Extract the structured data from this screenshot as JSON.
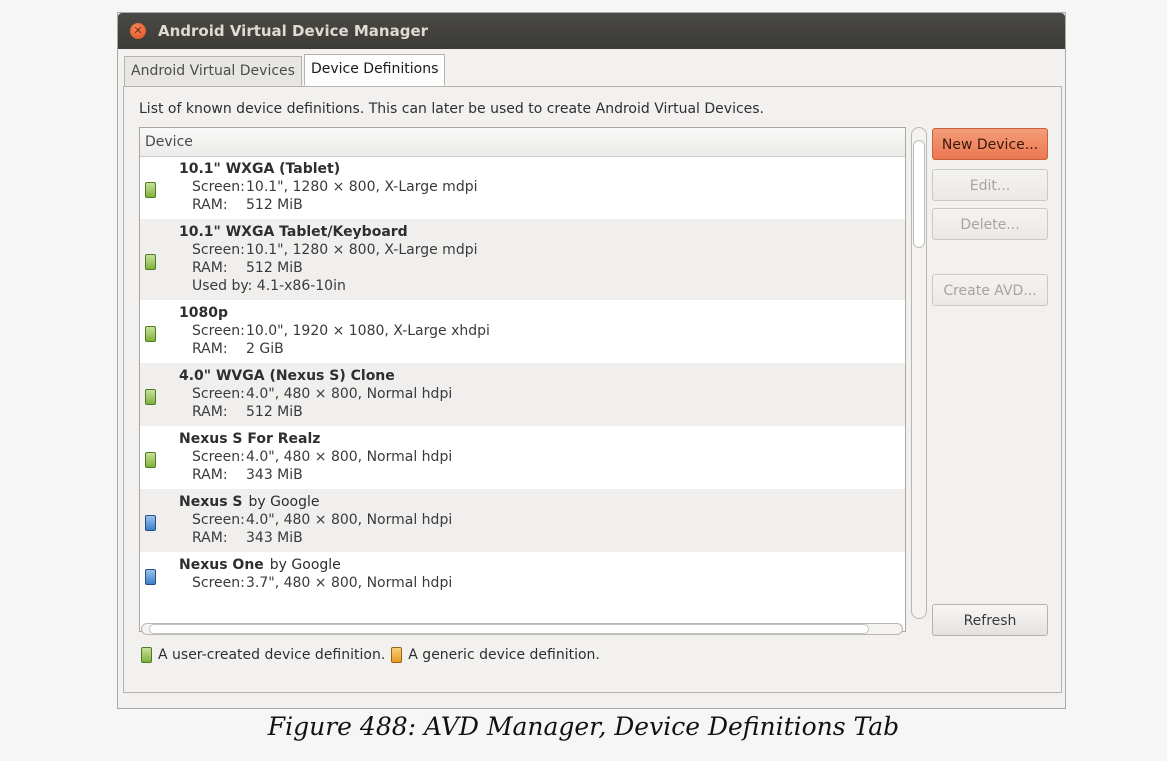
{
  "window": {
    "title": "Android Virtual Device Manager"
  },
  "tabs": [
    {
      "label": "Android Virtual Devices",
      "active": false
    },
    {
      "label": "Device Definitions",
      "active": true
    }
  ],
  "panel": {
    "description": "List of known device definitions. This can later be used to create Android Virtual Devices.",
    "column_header": "Device"
  },
  "devices": [
    {
      "name": "10.1\" WXGA (Tablet)",
      "by": "",
      "icon": "user-device-icon",
      "screen": "10.1\", 1280 × 800, X-Large mdpi",
      "ram": "512 MiB",
      "used_by": ""
    },
    {
      "name": "10.1\" WXGA Tablet/Keyboard",
      "by": "",
      "icon": "user-device-icon",
      "screen": "10.1\", 1280 × 800, X-Large mdpi",
      "ram": "512 MiB",
      "used_by": "Used by: 4.1-x86-10in"
    },
    {
      "name": "1080p",
      "by": "",
      "icon": "user-device-icon",
      "screen": "10.0\", 1920 × 1080, X-Large xhdpi",
      "ram": "2 GiB",
      "used_by": ""
    },
    {
      "name": "4.0\" WVGA (Nexus S) Clone",
      "by": "",
      "icon": "user-device-icon",
      "screen": "4.0\", 480 × 800, Normal hdpi",
      "ram": "512 MiB",
      "used_by": ""
    },
    {
      "name": "Nexus S For Realz",
      "by": "",
      "icon": "user-device-icon",
      "screen": "4.0\", 480 × 800, Normal hdpi",
      "ram": "343 MiB",
      "used_by": ""
    },
    {
      "name": "Nexus S",
      "by": "by Google",
      "icon": "generic-device-icon",
      "screen": "4.0\", 480 × 800, Normal hdpi",
      "ram": "343 MiB",
      "used_by": ""
    },
    {
      "name": "Nexus One",
      "by": "by Google",
      "icon": "generic-device-icon",
      "screen": "3.7\", 480 × 800, Normal hdpi",
      "ram": "",
      "used_by": ""
    }
  ],
  "labels": {
    "screen": "Screen:",
    "ram": "RAM:"
  },
  "buttons": {
    "new_device": "New Device...",
    "edit": "Edit...",
    "delete": "Delete...",
    "create_avd": "Create AVD...",
    "refresh": "Refresh"
  },
  "legend": {
    "user": "A user-created device definition.",
    "generic": "A generic device definition."
  },
  "caption": "Figure 488: AVD Manager, Device Definitions Tab",
  "colors": {
    "titlebar": "#3c3b37",
    "primary_button": "#ec7850",
    "user_icon": "#7fb13c",
    "generic_icon": "#e39a21"
  }
}
